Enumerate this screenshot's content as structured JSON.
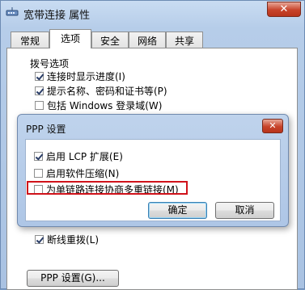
{
  "window": {
    "title": "宽带连接 属性",
    "close_glyph": "✕",
    "icon": "network-connection-icon"
  },
  "tabs": [
    {
      "label": "常规",
      "active": false
    },
    {
      "label": "选项",
      "active": true
    },
    {
      "label": "安全",
      "active": false
    },
    {
      "label": "网络",
      "active": false
    },
    {
      "label": "共享",
      "active": false
    }
  ],
  "dialing_options": {
    "group_label": "拨号选项",
    "items": [
      {
        "label": "连接时显示进度(I)",
        "checked": true
      },
      {
        "label": "提示名称、密码和证书等(P)",
        "checked": true
      },
      {
        "label": "包括 Windows 登录域(W)",
        "checked": false
      }
    ]
  },
  "redial": {
    "label": "断线重拨(L)",
    "checked": true
  },
  "ppp_settings_button": "PPP 设置(G)...",
  "ppp_dialog": {
    "title": "PPP 设置",
    "close_glyph": "✕",
    "options": [
      {
        "label": "启用 LCP 扩展(E)",
        "checked": true
      },
      {
        "label": "启用软件压缩(N)",
        "checked": false
      },
      {
        "label": "为单链路连接协商多重链接(M)",
        "checked": false
      }
    ],
    "ok_label": "确定",
    "cancel_label": "取消",
    "highlight_color": "#d0121a"
  }
}
